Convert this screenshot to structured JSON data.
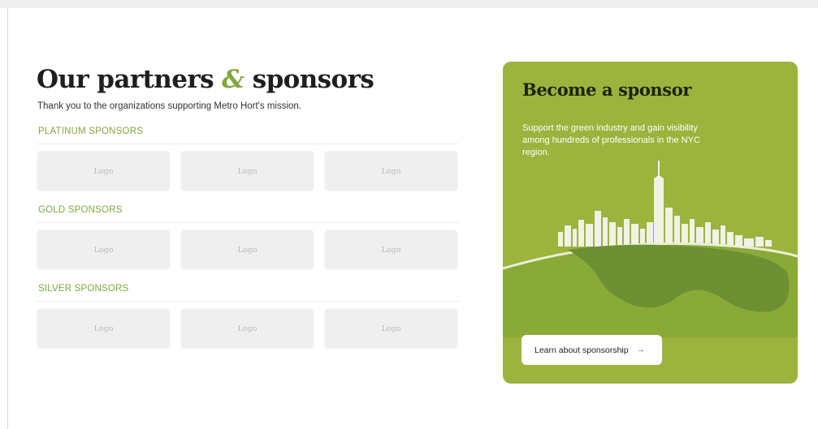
{
  "page": {
    "title_before": "Our partners",
    "title_amp": "&",
    "title_after": "sponsors",
    "subtitle": "Thank you to the organizations supporting Metro Hort's mission."
  },
  "tiers": [
    {
      "label": "PLATINUM SPONSORS",
      "logos": [
        "Logo",
        "Logo",
        "Logo"
      ]
    },
    {
      "label": "GOLD SPONSORS",
      "logos": [
        "Logo",
        "Logo",
        "Logo"
      ]
    },
    {
      "label": "SILVER SPONSORS",
      "logos": [
        "Logo",
        "Logo",
        "Logo"
      ]
    }
  ],
  "promo": {
    "title": "Become a sponsor",
    "text": "Support the green industry and gain visibility among hundreds of professionals in the NYC region.",
    "cta_label": "Learn about sponsorship",
    "cta_icon": "arrow-right-icon",
    "cta_arrow": "→"
  },
  "colors": {
    "accent": "#7fa83d",
    "card_bg": "#9cb33d",
    "hill_light": "#8aaa38",
    "hill_dark": "#6d9033",
    "logo_bg": "#efefef"
  }
}
